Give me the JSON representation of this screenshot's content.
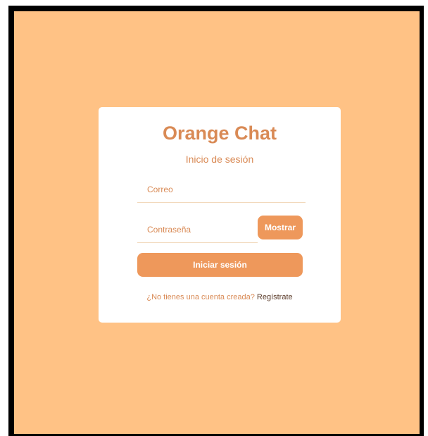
{
  "app": {
    "title": "Orange Chat",
    "subtitle": "Inicio de sesión"
  },
  "form": {
    "email_placeholder": "Correo",
    "email_value": "",
    "password_placeholder": "Contraseña",
    "password_value": "",
    "show_label": "Mostrar",
    "submit_label": "Iniciar sesión"
  },
  "footer": {
    "prompt": "¿No tienes una cuenta creada? ",
    "register_label": "Regístrate"
  },
  "colors": {
    "background": "#ffc285",
    "accent": "#ee985b",
    "text": "#d98a55",
    "link": "#5a3a28"
  }
}
